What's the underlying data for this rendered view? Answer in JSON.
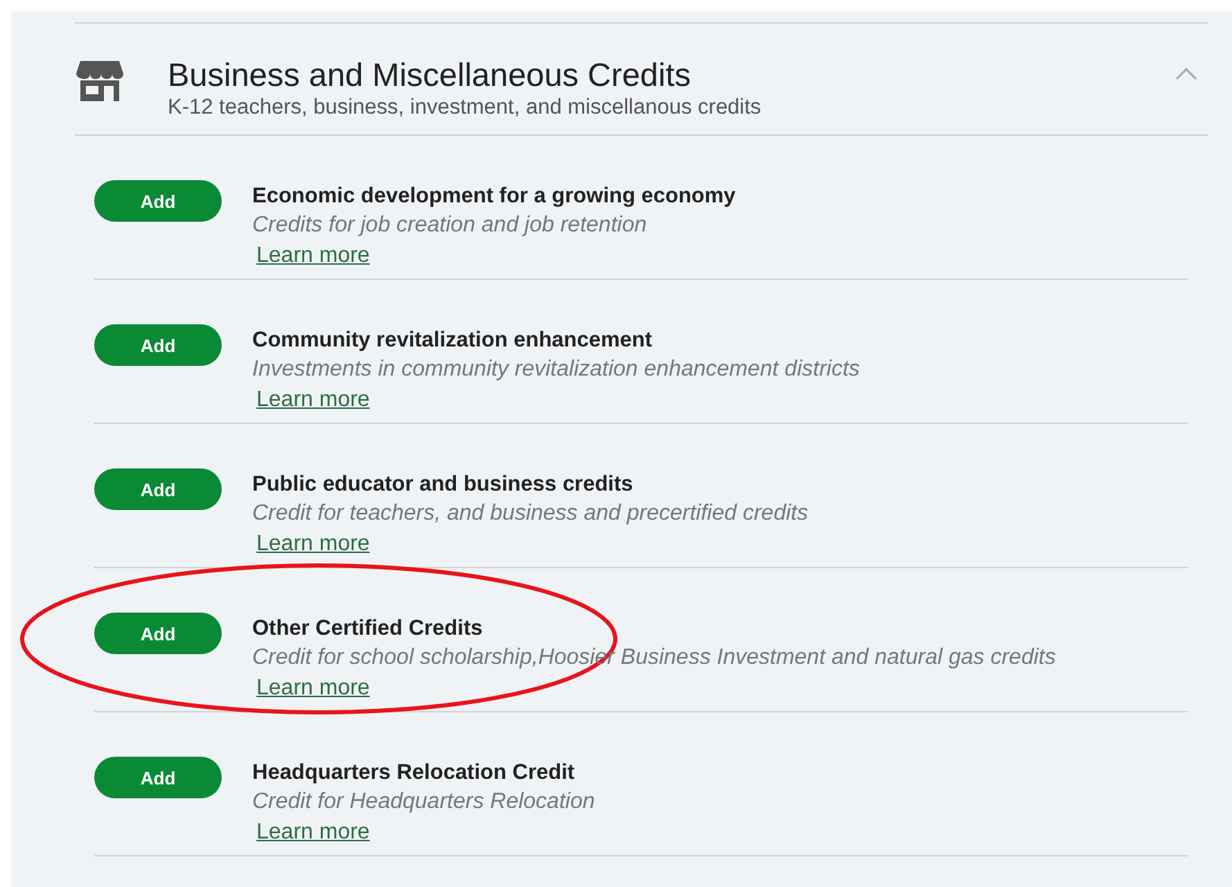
{
  "section": {
    "title": "Business and Miscellaneous Credits",
    "subtitle": "K-12 teachers, business, investment, and miscellanous credits",
    "expanded": true
  },
  "credits": [
    {
      "button": "Add",
      "title": "Economic development for a growing economy",
      "description": "Credits for job creation and job retention",
      "link": "Learn more",
      "highlighted": false
    },
    {
      "button": "Add",
      "title": "Community revitalization enhancement",
      "description": "Investments in community revitalization enhancement districts",
      "link": "Learn more",
      "highlighted": false
    },
    {
      "button": "Add",
      "title": "Public educator and business credits",
      "description": "Credit for teachers, and business and precertified credits",
      "link": "Learn more",
      "highlighted": false
    },
    {
      "button": "Add",
      "title": "Other Certified Credits",
      "description": "Credit for school scholarship,Hoosier Business Investment and natural gas credits",
      "link": "Learn more",
      "highlighted": true
    },
    {
      "button": "Add",
      "title": "Headquarters Relocation Credit",
      "description": "Credit for Headquarters Relocation",
      "link": "Learn more",
      "highlighted": false
    }
  ]
}
